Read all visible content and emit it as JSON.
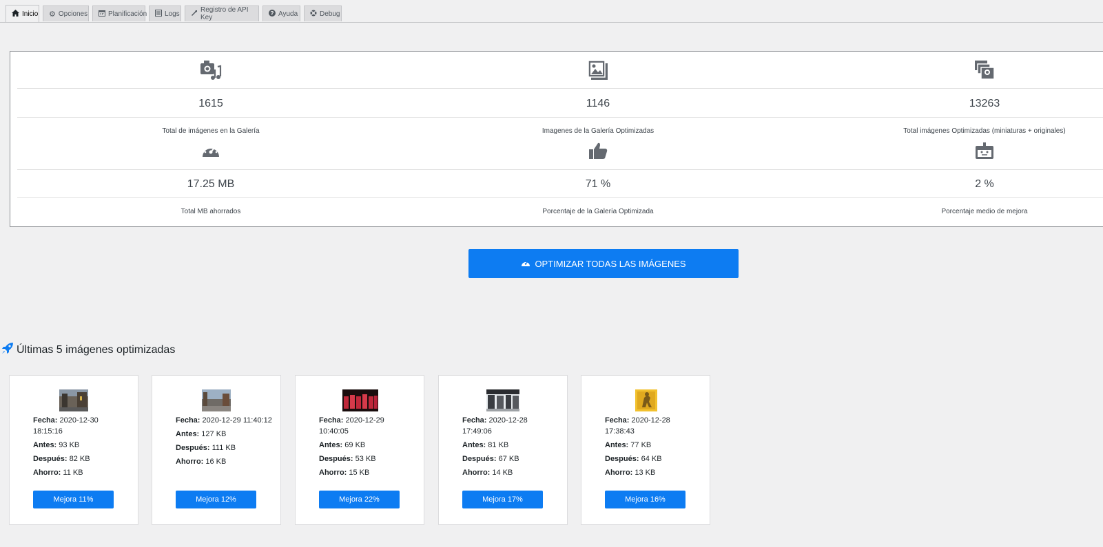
{
  "tabs": [
    {
      "label": "Inicio",
      "icon": "home-icon"
    },
    {
      "label": "Opciones",
      "icon": "gear-icon"
    },
    {
      "label": "Planificación",
      "icon": "calendar-icon"
    },
    {
      "label": "Logs",
      "icon": "list-icon"
    },
    {
      "label": "Registro de API Key",
      "icon": "wrench-icon"
    },
    {
      "label": "Ayuda",
      "icon": "question-icon"
    },
    {
      "label": "Debug",
      "icon": "lifebuoy-icon"
    }
  ],
  "stats": [
    {
      "value": "1615",
      "label": "Total de imágenes en la Galería",
      "icon": "camera-music-icon"
    },
    {
      "value": "1146",
      "label": "Imagenes de la Galería Optimizadas",
      "icon": "images-icon"
    },
    {
      "value": "13263",
      "label": "Total imágenes Optimizadas (miniaturas + originales)",
      "icon": "photo-stack-icon"
    },
    {
      "value": "17.25 MB",
      "label": "Total MB ahorrados",
      "icon": "speedometer-icon"
    },
    {
      "value": "71 %",
      "label": "Porcentaje de la Galería Optimizada",
      "icon": "thumbs-up-icon"
    },
    {
      "value": "2 %",
      "label": "Porcentaje medio de mejora",
      "icon": "robot-icon"
    }
  ],
  "optimize_button": {
    "label": "OPTIMIZAR TODAS LAS IMÁGENES",
    "icon": "speedometer-icon"
  },
  "recent": {
    "title": "Últimas 5 imágenes optimizadas",
    "icon": "rocket-icon",
    "field_labels": {
      "date": "Fecha:",
      "before": "Antes:",
      "after": "Después:",
      "saving": "Ahorro:"
    },
    "items": [
      {
        "date": "2020-12-30 18:15:16",
        "before": "93 KB",
        "after": "82 KB",
        "saving": "11 KB",
        "button": "Mejora 11%"
      },
      {
        "date": "2020-12-29 11:40:12",
        "before": "127 KB",
        "after": "111 KB",
        "saving": "16 KB",
        "button": "Mejora 12%"
      },
      {
        "date": "2020-12-29 10:40:05",
        "before": "69 KB",
        "after": "53 KB",
        "saving": "15 KB",
        "button": "Mejora 22%"
      },
      {
        "date": "2020-12-28 17:49:06",
        "before": "81 KB",
        "after": "67 KB",
        "saving": "14 KB",
        "button": "Mejora 17%"
      },
      {
        "date": "2020-12-28 17:38:43",
        "before": "77 KB",
        "after": "64 KB",
        "saving": "13 KB",
        "button": "Mejora 16%"
      }
    ]
  },
  "colors": {
    "accent": "#0d7cf2",
    "icon_gray": "#646970"
  }
}
